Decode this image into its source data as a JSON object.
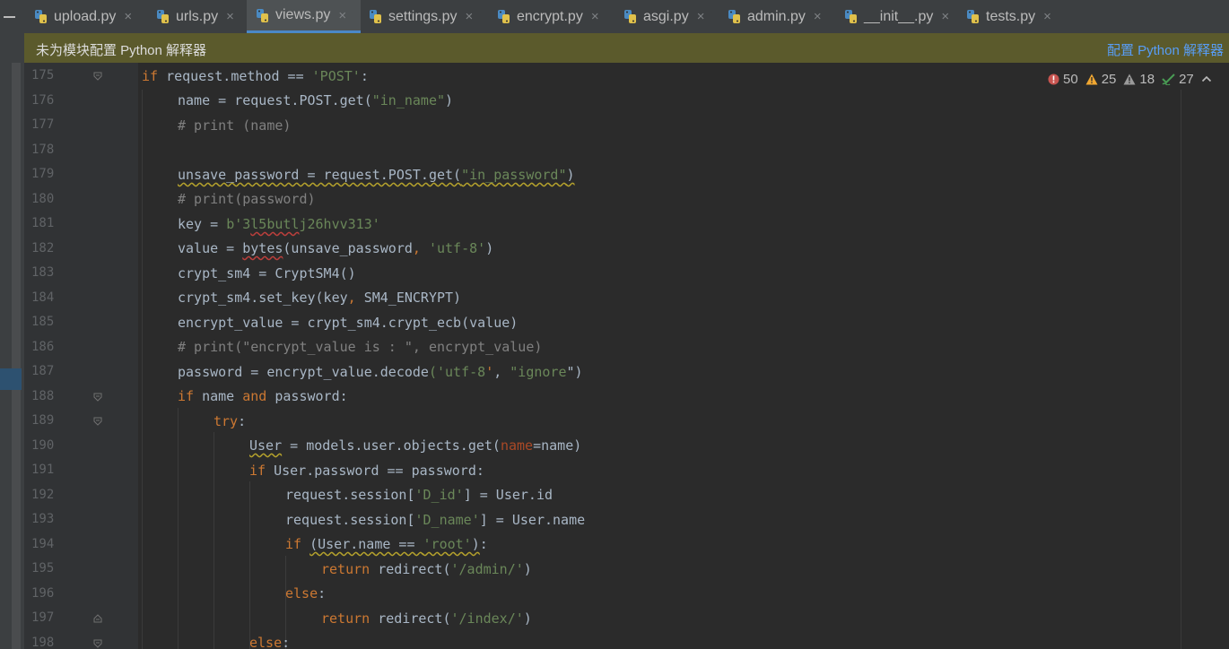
{
  "tabs": [
    {
      "name": "upload.py",
      "active": false
    },
    {
      "name": "urls.py",
      "active": false
    },
    {
      "name": "views.py",
      "active": true
    },
    {
      "name": "settings.py",
      "active": false
    },
    {
      "name": "encrypt.py",
      "active": false
    },
    {
      "name": "asgi.py",
      "active": false
    },
    {
      "name": "admin.py",
      "active": false
    },
    {
      "name": "__init__.py",
      "active": false
    },
    {
      "name": "tests.py",
      "active": false
    }
  ],
  "tab_close_glyph": "×",
  "banner": {
    "message": "未为模块配置 Python 解释器",
    "action": "配置 Python 解释器"
  },
  "inspections": {
    "errors": "50",
    "warnings": "25",
    "weak_warnings": "18",
    "typos": "27"
  },
  "editor": {
    "line_numbers": [
      "175",
      "176",
      "177",
      "178",
      "179",
      "180",
      "181",
      "182",
      "183",
      "184",
      "185",
      "186",
      "187",
      "188",
      "189",
      "190",
      "191",
      "192",
      "193",
      "194",
      "195",
      "196",
      "197",
      "198"
    ],
    "code_lines": [
      "if request.method == 'POST':",
      "name = request.POST.get(\"in_name\")",
      "# print (name)",
      "",
      "unsave_password = request.POST.get(\"in_password\")",
      "# print(password)",
      "key = b'3l5butlj26hvv313'",
      "value = bytes(unsave_password, 'utf-8')",
      "crypt_sm4 = CryptSM4()",
      "crypt_sm4.set_key(key, SM4_ENCRYPT)",
      "encrypt_value = crypt_sm4.crypt_ecb(value)",
      "# print(\"encrypt_value is : \", encrypt_value)",
      "password = encrypt_value.decode('utf-8', \"ignore\")",
      "if name and password:",
      "try:",
      "User = models.user.objects.get(name=name)",
      "if User.password == password:",
      "request.session['D_id'] = User.id",
      "request.session['D_name'] = User.name",
      "if (User.name == 'root'):",
      "return redirect('/admin/')",
      "else:",
      "return redirect('/index/')",
      "else:"
    ]
  },
  "colors": {
    "keyword": "#cc7832",
    "string": "#6a8759",
    "comment": "#808080",
    "param": "#aa4926",
    "text": "#a9b7c6"
  }
}
